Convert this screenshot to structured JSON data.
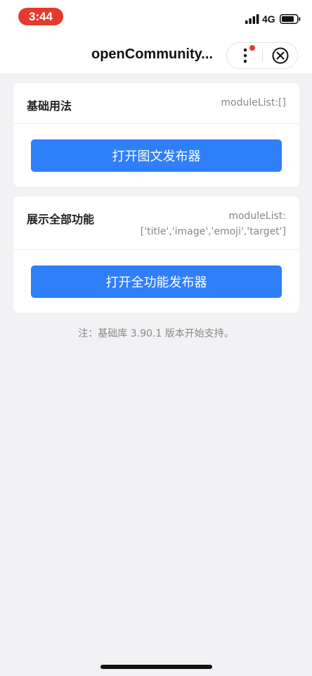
{
  "status_bar": {
    "time": "3:44",
    "network": "4G",
    "time_pill_color": "#e53a2f"
  },
  "nav": {
    "title": "openCommunity...",
    "more_icon": "more-dots-icon",
    "close_icon": "close-circle-icon",
    "notification_dot_color": "#e53a2f"
  },
  "sections": [
    {
      "title": "基础用法",
      "meta": "moduleList:[]",
      "button_label": "打开图文发布器"
    },
    {
      "title": "展示全部功能",
      "meta_line1": "moduleList:",
      "meta_line2": "['title','image','emoji','target']",
      "button_label": "打开全功能发布器"
    }
  ],
  "note": "注：基础库 3.90.1 版本开始支持。",
  "colors": {
    "accent": "#2f7ff8",
    "background": "#f2f2f4"
  }
}
